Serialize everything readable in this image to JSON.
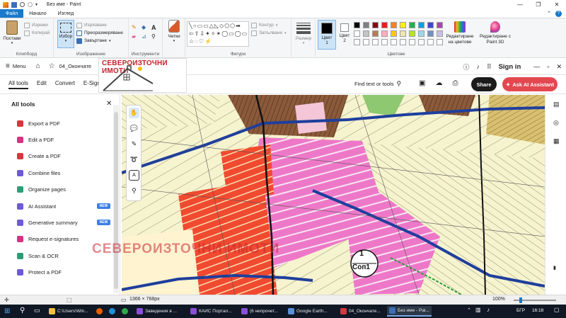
{
  "paint": {
    "window_title": "Без име - Paint",
    "tabs": [
      "Файл",
      "Начало",
      "Изглед"
    ],
    "clipboard": {
      "paste": "Постави",
      "cut": "Изрежи",
      "copy": "Копирай",
      "label": "Клипборд"
    },
    "image": {
      "select": "Избор",
      "crop": "Изрязване",
      "resize": "Преоразмеряване",
      "rotate": "Завъртане",
      "label": "Изображение"
    },
    "tools_label": "Инструменти",
    "brushes": "Четки",
    "shapes": {
      "outline": "Контур",
      "fill": "Запълване",
      "label": "Фигури"
    },
    "size": "Размер",
    "color1": "Цвят 1",
    "color2": "Цвят 2",
    "colors_label": "Цветове",
    "edit_colors": "Редактиране на цветове",
    "paint3d": "Редактиране с Paint 3D",
    "palette": [
      "#000000",
      "#7f7f7f",
      "#880015",
      "#ed1c24",
      "#ff7f27",
      "#fff200",
      "#22b14c",
      "#00a2e8",
      "#3f48cc",
      "#a349a4",
      "#ffffff",
      "#c3c3c3",
      "#b97a57",
      "#ffaec9",
      "#ffc90e",
      "#efe4b0",
      "#b5e61d",
      "#99d9ea",
      "#7092be",
      "#c8bfe7"
    ],
    "status": {
      "resolution": "1366 × 768px",
      "zoom": "100%"
    }
  },
  "acrobat": {
    "menu": "Menu",
    "doc_name": "04_Окончате",
    "sign_in": "Sign in",
    "tabs": [
      "All tools",
      "Edit",
      "Convert",
      "E-Sign"
    ],
    "find": "Find text or tools",
    "share": "Share",
    "ai": "Ask AI Assistant",
    "panel_title": "All tools",
    "tools": [
      {
        "label": "Export a PDF",
        "color": "#d7373f"
      },
      {
        "label": "Edit a PDF",
        "color": "#d63384"
      },
      {
        "label": "Create a PDF",
        "color": "#d7373f"
      },
      {
        "label": "Combine files",
        "color": "#6e5ad6"
      },
      {
        "label": "Organize pages",
        "color": "#2d9d78"
      },
      {
        "label": "AI Assistant",
        "color": "#6e5ad6",
        "badge": "NEW"
      },
      {
        "label": "Generative summary",
        "color": "#6e5ad6",
        "badge": "NEW"
      },
      {
        "label": "Request e-signatures",
        "color": "#d63384"
      },
      {
        "label": "Scan & OCR",
        "color": "#2d9d78"
      },
      {
        "label": "Protect a PDF",
        "color": "#6e5ad6"
      }
    ]
  },
  "logo": {
    "text": "СЕВЕРОИЗТОЧНИ ИМОТИ"
  },
  "watermark": "СЕВЕРОИЗТОЧНИ ИМОТИ",
  "map_label": {
    "top": "1",
    "bottom": "Соп1"
  },
  "taskbar": {
    "items": [
      {
        "label": "C:\\Users\\Win..."
      },
      {
        "label": "Заведения в ..."
      },
      {
        "label": "КАИС Портал..."
      },
      {
        "label": "(6 непрочет..."
      },
      {
        "label": "Google Earth..."
      },
      {
        "label": "04_Окончате..."
      },
      {
        "label": "Без име - Pai..."
      }
    ],
    "lang": "БГР",
    "time": "16:18"
  }
}
